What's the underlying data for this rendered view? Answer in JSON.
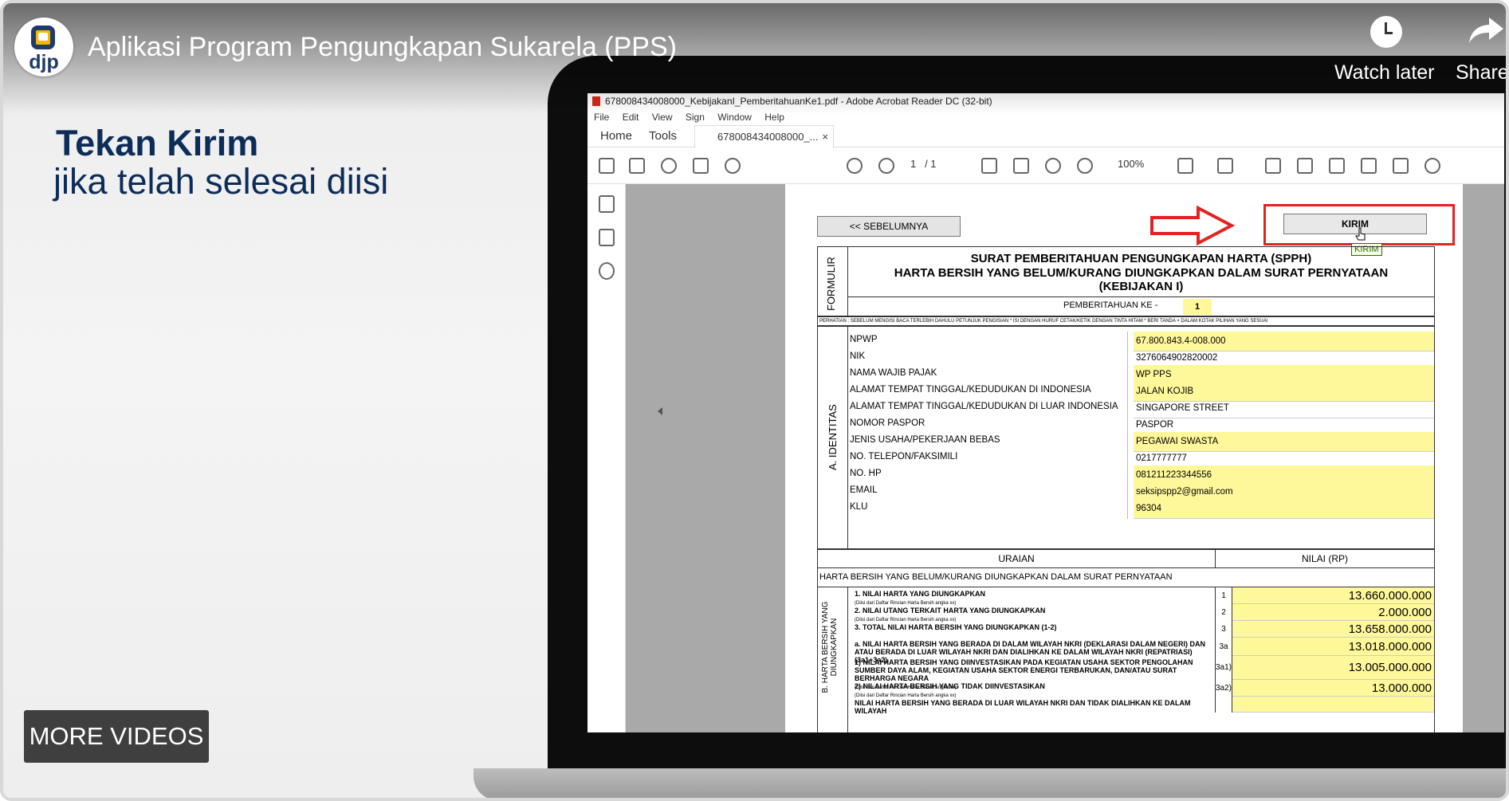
{
  "video": {
    "title": "Aplikasi Program Pengungkapan Sukarela (PPS)",
    "channel_logo_text": "djp",
    "watch_later": "Watch later",
    "share": "Share",
    "more_videos": "MORE VIDEOS",
    "caption_bold": "Tekan Kirim",
    "caption_rest": "jika telah selesai diisi"
  },
  "acrobat": {
    "window_title": "678008434008000_KebijakanI_PemberitahuanKe1.pdf - Adobe Acrobat Reader DC (32-bit)",
    "menu": [
      "File",
      "Edit",
      "View",
      "Sign",
      "Window",
      "Help"
    ],
    "tabs": {
      "home": "Home",
      "tools": "Tools",
      "doc": "678008434008000_...",
      "close": "×"
    },
    "page_current": "1",
    "page_total": "/ 1",
    "zoom": "100%"
  },
  "form": {
    "prev_button": "<< SEBELUMNYA",
    "kirim_button": "KIRIM",
    "kirim_tooltip": "KIRIM",
    "formulir": "FORMULIR",
    "title1": "SURAT PEMBERITAHUAN PENGUNGKAPAN HARTA (SPPH)",
    "title2": "HARTA BERSIH YANG BELUM/KURANG DIUNGKAPKAN DALAM SURAT PERNYATAAN",
    "title3": "(KEBIJAKAN I)",
    "pemberitahuan_label": "PEMBERITAHUAN KE -",
    "pemberitahuan_value": "1",
    "perhatian": "PERHATIAN : SEBELUM MENGISI BACA TERLEBIH DAHULU PETUNJUK PENGISIAN   * ISI DENGAN HURUF CETAK/KETIK DENGAN TINTA HITAM   * BERI TANDA × DALAM KOTAK PILIHAN YANG SESUAI",
    "section_a": "A. IDENTITAS",
    "identity": [
      {
        "label": "NPWP",
        "value": "67.800.843.4-008.000",
        "yellow": true
      },
      {
        "label": "NIK",
        "value": "3276064902820002",
        "yellow": false
      },
      {
        "label": "NAMA WAJIB PAJAK",
        "value": "WP PPS",
        "yellow": true
      },
      {
        "label": "ALAMAT TEMPAT TINGGAL/KEDUDUKAN DI INDONESIA",
        "value": "JALAN KOJIB",
        "yellow": true
      },
      {
        "label": "ALAMAT TEMPAT TINGGAL/KEDUDUKAN DI LUAR INDONESIA",
        "value": "SINGAPORE STREET",
        "yellow": false
      },
      {
        "label": "NOMOR PASPOR",
        "value": "PASPOR",
        "yellow": false
      },
      {
        "label": "JENIS USAHA/PEKERJAAN BEBAS",
        "value": "PEGAWAI SWASTA",
        "yellow": true
      },
      {
        "label": "NO. TELEPON/FAKSIMILI",
        "value": "0217777777",
        "yellow": false
      },
      {
        "label": "NO. HP",
        "value": "081211223344556",
        "yellow": true
      },
      {
        "label": "EMAIL",
        "value": "seksipspp2@gmail.com",
        "yellow": true
      },
      {
        "label": "KLU",
        "value": "96304",
        "yellow": true
      }
    ],
    "uraian": "URAIAN",
    "nilai": "NILAI (RP)",
    "hb_line": "HARTA BERSIH YANG BELUM/KURANG DIUNGKAPKAN DALAM SURAT PERNYATAAN",
    "section_b": "B. HARTA BERSIH YANG DIUNGKAPKAN",
    "rows": [
      {
        "label": "1.   NILAI HARTA YANG DIUNGKAPKAN",
        "sub": "(Diisi dari Daftar Rincian Harta Bersih angka xx)",
        "num": "1",
        "value": "13.660.000.000"
      },
      {
        "label": "2.   NILAI UTANG TERKAIT HARTA YANG DIUNGKAPKAN",
        "sub": "(Diisi dari Daftar Rincian Harta Bersih angka xx)",
        "num": "2",
        "value": "2.000.000"
      },
      {
        "label": "3.   TOTAL NILAI HARTA BERSIH YANG DIUNGKAPKAN (1-2)",
        "sub": "",
        "num": "3",
        "value": "13.658.000.000"
      },
      {
        "label": "a.   NILAI HARTA BERSIH YANG BERADA DI DALAM WILAYAH NKRI (DEKLARASI DALAM NEGERI) DAN ATAU BERADA DI LUAR WILAYAH NKRI DAN DIALIHKAN KE DALAM WILAYAH NKRI (REPATRIASI) (3a1+3a2)",
        "sub": "",
        "num": "3a",
        "value": "13.018.000.000"
      },
      {
        "label": "1)   NILAI HARTA BERSIH YANG DIINVESTASIKAN PADA KEGIATAN USAHA SEKTOR PENGOLAHAN SUMBER DAYA ALAM, KEGIATAN USAHA SEKTOR ENERGI TERBARUKAN, DAN/ATAU SURAT BERHARGA NEGARA",
        "sub": "(Diisi dari Daftar Rincian Harta Bersih angka xx)",
        "num": "3a1)",
        "value": "13.005.000.000"
      },
      {
        "label": "2)   NILAI HARTA BERSIH YANG TIDAK DIINVESTASIKAN",
        "sub": "(Diisi dari Daftar Rincian Harta Bersih angka xx)",
        "num": "3a2)",
        "value": "13.000.000"
      },
      {
        "label": "     NILAI HARTA BERSIH YANG BERADA DI LUAR WILAYAH NKRI DAN TIDAK DIALIHKAN KE DALAM WILAYAH",
        "sub": "",
        "num": "",
        "value": ""
      }
    ]
  },
  "colors": {
    "highlight": "#e32322",
    "field_yellow": "#fff89a",
    "caption": "#0d2d59"
  }
}
